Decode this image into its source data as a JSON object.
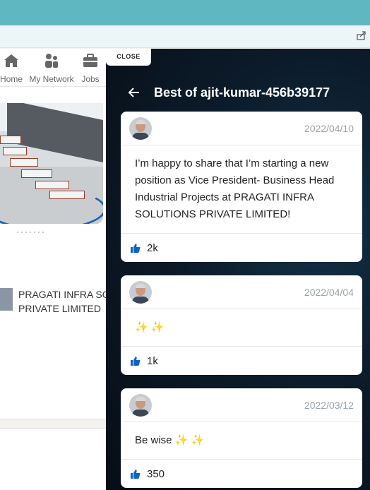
{
  "left_nav": {
    "items": [
      {
        "label": "Home",
        "icon": "home-icon"
      },
      {
        "label": "My Network",
        "icon": "network-icon"
      },
      {
        "label": "Jobs",
        "icon": "briefcase-icon"
      }
    ]
  },
  "company": {
    "name_line1": "PRAGATI INFRA SO",
    "name_line2": "PRIVATE LIMITED"
  },
  "panel": {
    "close_label": "CLOSE",
    "title": "Best of ajit-kumar-456b39177",
    "posts": [
      {
        "date": "2022/04/10",
        "text": "I’m happy to share that I’m starting a new position as Vice President- Business Head Industrial Projects at PRAGATI INFRA SOLUTIONS PRIVATE LIMITED!",
        "likes": "2k"
      },
      {
        "date": "2022/04/04",
        "text": "✨ ✨",
        "likes": "1k"
      },
      {
        "date": "2022/03/12",
        "text": "Be wise ✨ ✨",
        "likes": "350"
      }
    ]
  },
  "colors": {
    "browser_top": "#5fb8c1",
    "panel_bg": "#0c1b2a",
    "like_blue": "#0a66c2"
  }
}
